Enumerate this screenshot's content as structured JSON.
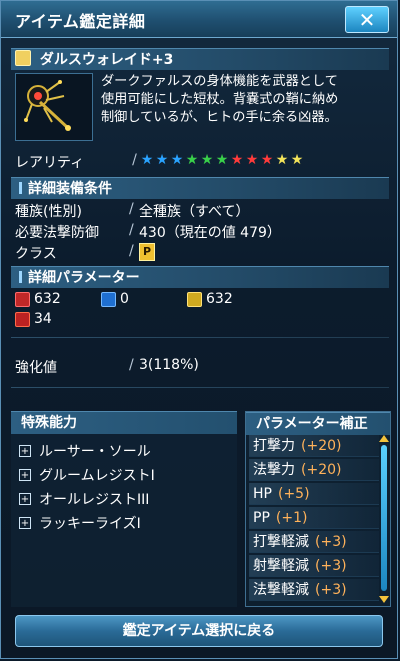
{
  "window": {
    "title": "アイテム鑑定詳細",
    "close_label": "✕"
  },
  "item": {
    "name": "ダルスウォレイド+3",
    "icon": "wand-icon",
    "description_lines": [
      "ダークファルスの身体機能を武器として",
      "使用可能にした短杖。背嚢式の鞘に納め",
      "制御しているが、ヒトの手に余る凶器。"
    ]
  },
  "rarity": {
    "label": "レアリティ",
    "separator": "/",
    "stars": [
      {
        "color": "#2aa3ff"
      },
      {
        "color": "#2aa3ff"
      },
      {
        "color": "#2aa3ff"
      },
      {
        "color": "#39d04a"
      },
      {
        "color": "#39d04a"
      },
      {
        "color": "#39d04a"
      },
      {
        "color": "#ff3b3b"
      },
      {
        "color": "#ff3b3b"
      },
      {
        "color": "#ff3b3b"
      },
      {
        "color": "#f3e45a"
      },
      {
        "color": "#f3e45a"
      }
    ],
    "count": 11
  },
  "equip_conditions": {
    "header": "詳細装備条件",
    "rows": [
      {
        "label": "種族(性別)",
        "value": "全種族（すべて）"
      },
      {
        "label": "必要法撃防御",
        "value": "430（現在の値 479）"
      },
      {
        "label": "クラス",
        "value": ""
      }
    ],
    "class_icon": "class-badge-icon"
  },
  "parameters": {
    "header": "詳細パラメーター",
    "strike": "632",
    "range": "0",
    "tech": "632",
    "fire": "34"
  },
  "enhancement": {
    "label": "強化値",
    "value": "3(118%)"
  },
  "special_abilities": {
    "header": "特殊能力",
    "items": [
      "ルーサー・ソール",
      "グルームレジストI",
      "オールレジストIII",
      "ラッキーライズI"
    ]
  },
  "parameter_bonus": {
    "header": "パラメーター補正",
    "items": [
      {
        "label": "打撃力",
        "value": "(+20)"
      },
      {
        "label": "法撃力",
        "value": "(+20)"
      },
      {
        "label": "HP",
        "value": "(+5)"
      },
      {
        "label": "PP",
        "value": "(+1)"
      },
      {
        "label": "打撃軽減",
        "value": "(+3)"
      },
      {
        "label": "射撃軽減",
        "value": "(+3)"
      },
      {
        "label": "法撃軽減",
        "value": "(+3)"
      }
    ]
  },
  "footer": {
    "return_button": "鑑定アイテム選択に戻る"
  },
  "colors": {
    "accent": "#2f6d92",
    "bonus_value": "#ffb25a",
    "button": "#2a6b97"
  }
}
